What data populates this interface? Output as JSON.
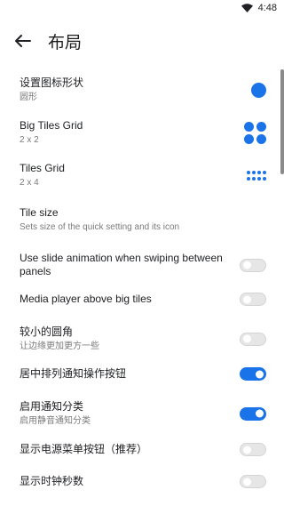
{
  "status_bar": {
    "time": "4:48"
  },
  "app_bar": {
    "title": "布局"
  },
  "colors": {
    "accent": "#1a73e8",
    "toggle_off": "#e6e6e6"
  },
  "settings": [
    {
      "label": "设置图标形状",
      "sub": "圆形",
      "control": "dot"
    },
    {
      "label": "Big Tiles Grid",
      "sub": "2 x 2",
      "control": "grid2x2"
    },
    {
      "label": "Tiles Grid",
      "sub": "2 x 4",
      "control": "grid2x4"
    },
    {
      "label": "Tile size",
      "sub": "Sets size of the quick setting and its icon",
      "control": "none"
    },
    {
      "label": "Use slide animation when swiping between panels",
      "sub": "",
      "control": "toggle",
      "on": false
    },
    {
      "label": "Media player above big tiles",
      "sub": "",
      "control": "toggle",
      "on": false
    },
    {
      "label": "较小的圆角",
      "sub": "让边缘更加更方一些",
      "control": "toggle",
      "on": false
    },
    {
      "label": "居中排列通知操作按钮",
      "sub": "",
      "control": "toggle",
      "on": true
    },
    {
      "label": "启用通知分类",
      "sub": "启用静音通知分类",
      "control": "toggle",
      "on": true
    },
    {
      "label": "显示电源菜单按钮（推荐）",
      "sub": "",
      "control": "toggle",
      "on": false
    },
    {
      "label": "显示时钟秒数",
      "sub": "",
      "control": "toggle",
      "on": false
    }
  ]
}
